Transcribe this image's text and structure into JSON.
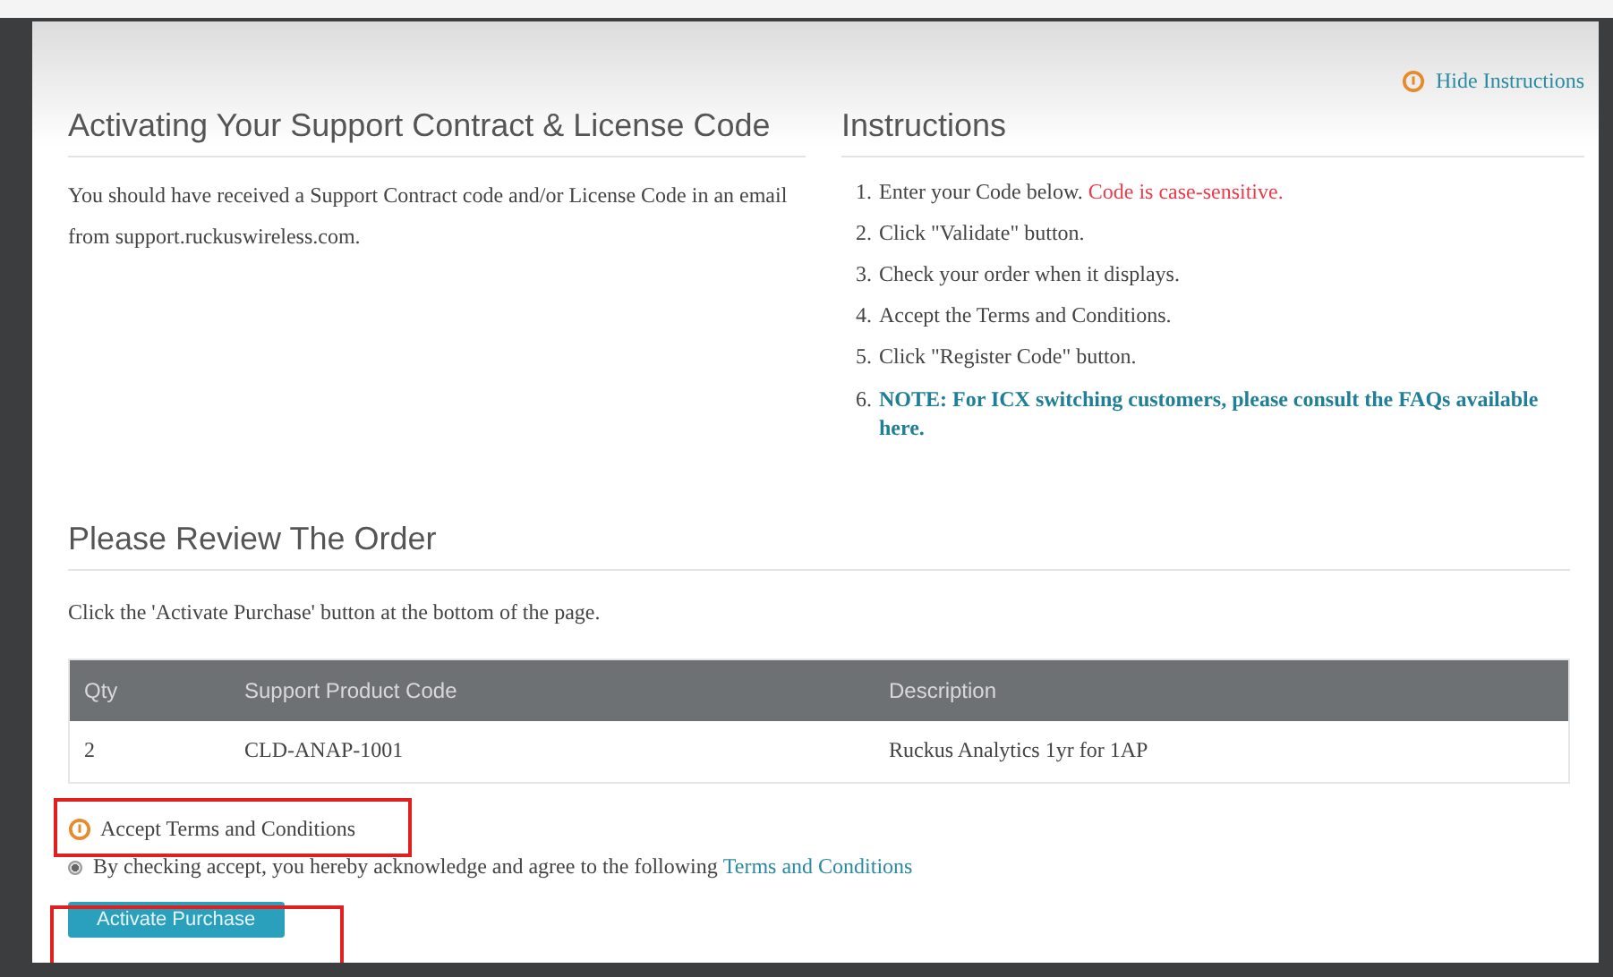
{
  "hide_instructions_link": "Hide Instructions",
  "activation": {
    "title": "Activating Your Support Contract & License Code",
    "text": "You should have received a Support Contract code and/or License Code in an email from support.ruckuswireless.com."
  },
  "instructions": {
    "title": "Instructions",
    "steps": [
      {
        "kind": "step",
        "number": "1.",
        "text": "Enter your Code below.",
        "warning": "Code is case-sensitive."
      },
      {
        "kind": "step",
        "number": "2.",
        "text": "Click \"Validate\" button."
      },
      {
        "kind": "step",
        "number": "3.",
        "text": "Check your order when it displays."
      },
      {
        "kind": "step",
        "number": "4.",
        "text": "Accept the Terms and Conditions."
      },
      {
        "kind": "step",
        "number": "5.",
        "text": "Click \"Register Code\" button."
      },
      {
        "kind": "note",
        "number": "6.",
        "text": "NOTE: For ICX  switching customers, please consult the FAQs available here."
      }
    ]
  },
  "review": {
    "title": "Please Review The Order",
    "text": "Click the 'Activate Purchase' button at the bottom of the page.",
    "table": {
      "columns": [
        "Qty",
        "Support Product Code",
        "Description"
      ],
      "rows": [
        [
          "2",
          "CLD-ANAP-1001",
          "Ruckus Analytics 1yr for 1AP"
        ]
      ]
    }
  },
  "terms": {
    "title": "Accept Terms and Conditions",
    "checked": true,
    "text": "By checking accept, you hereby acknowledge and agree to the following",
    "link": "Terms and Conditions"
  },
  "activate_button": "Activate Purchase"
}
